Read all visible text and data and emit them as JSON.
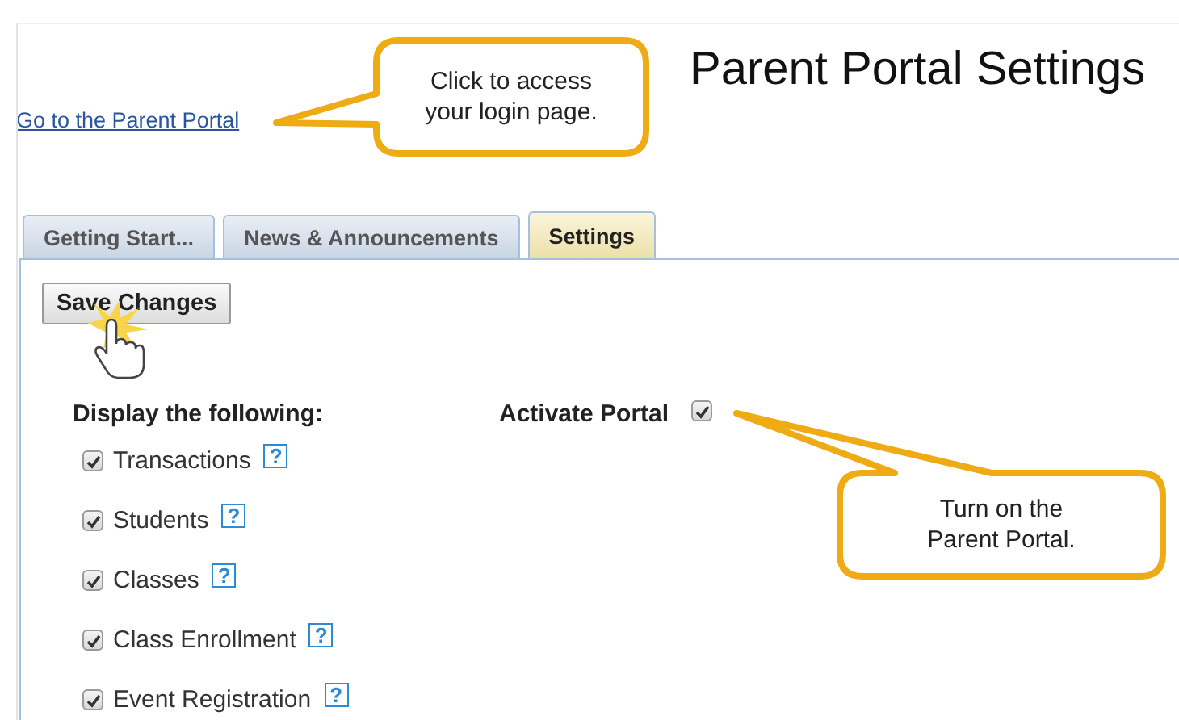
{
  "link": {
    "text": "Go to the Parent Portal"
  },
  "title": "Parent Portal Settings",
  "tabs": [
    {
      "label": "Getting Start...",
      "selected": false
    },
    {
      "label": "News & Announcements",
      "selected": false
    },
    {
      "label": "Settings",
      "selected": true
    }
  ],
  "save_button": {
    "label": "Save Changes"
  },
  "display_heading": "Display the following:",
  "options": [
    {
      "label": "Transactions",
      "checked": true,
      "help": "?"
    },
    {
      "label": "Students",
      "checked": true,
      "help": "?"
    },
    {
      "label": "Classes",
      "checked": true,
      "help": "?"
    },
    {
      "label": "Class Enrollment",
      "checked": true,
      "help": "?"
    },
    {
      "label": "Event Registration",
      "checked": true,
      "help": "?"
    }
  ],
  "activate": {
    "label": "Activate Portal",
    "checked": true
  },
  "callouts": [
    {
      "lines": [
        "Click to access",
        "your login page."
      ]
    },
    {
      "lines": [
        "Turn on the",
        "Parent Portal."
      ]
    }
  ]
}
